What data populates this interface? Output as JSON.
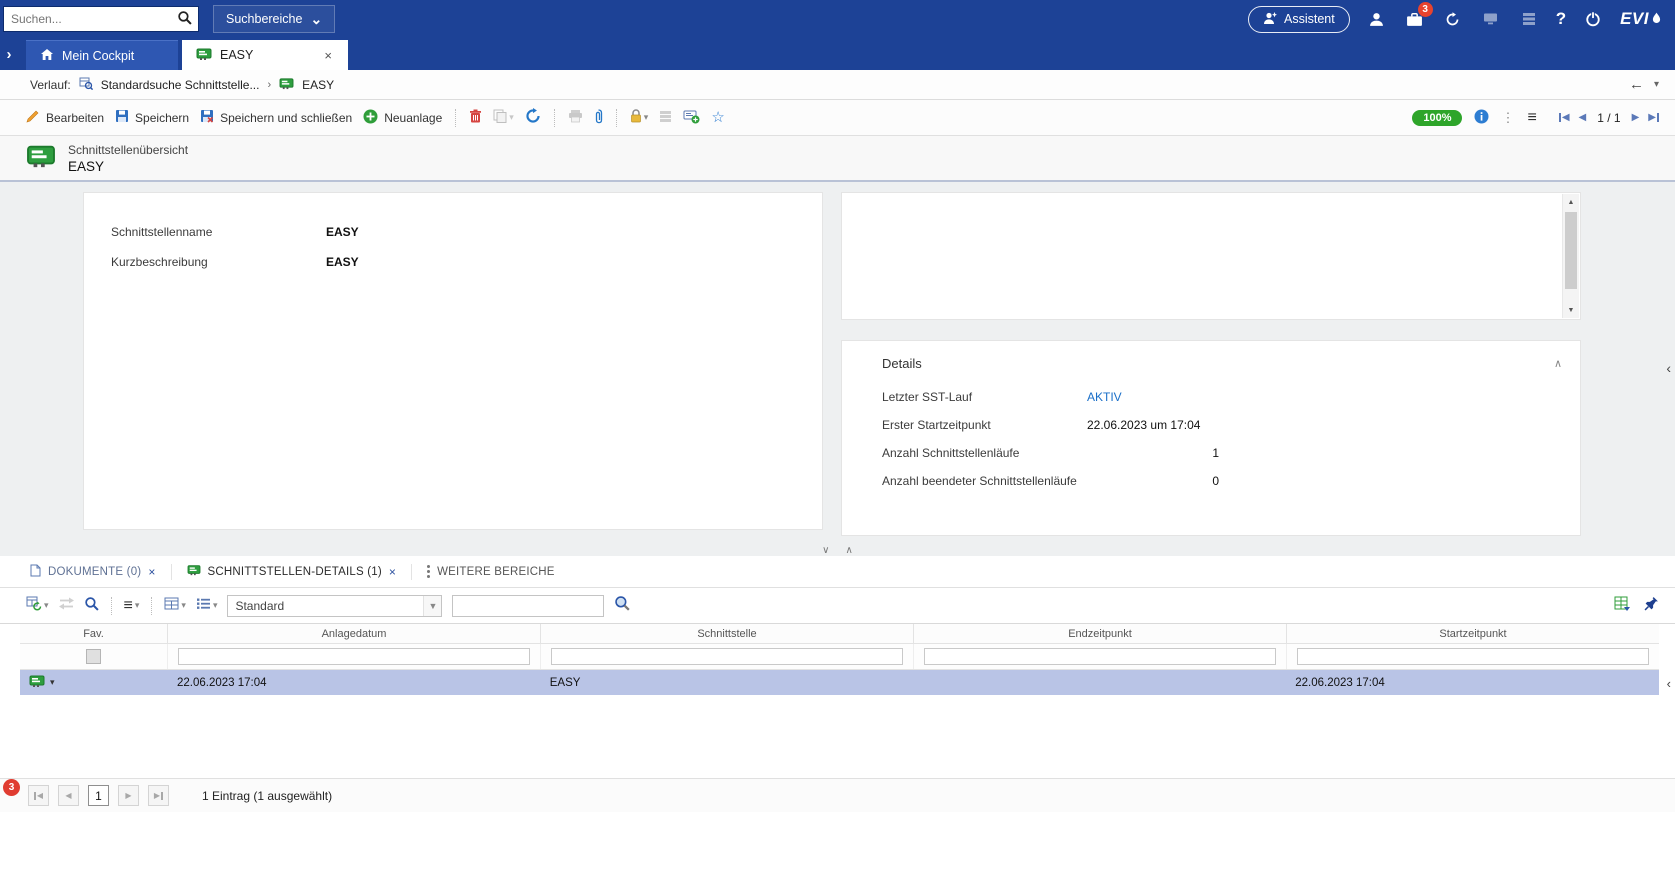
{
  "colors": {
    "topbar_blue": "#1d4296",
    "selection_row": "#b9c4e6",
    "status_green": "#2ea52a",
    "link_blue": "#1a6fc8",
    "alert_red": "#e03c31",
    "icon_green": "#2e9e3f"
  },
  "topbar": {
    "search_placeholder": "Suchen...",
    "scope_button": "Suchbereiche",
    "assistant_label": "Assistent",
    "notification_count": "3",
    "help_label": "?",
    "brand": "EVI"
  },
  "tabs": [
    {
      "label": "Mein Cockpit"
    },
    {
      "label": "EASY"
    }
  ],
  "breadcrumb": {
    "prefix": "Verlauf:",
    "items": [
      {
        "label": "Standardsuche Schnittstelle..."
      },
      {
        "label": "EASY"
      }
    ]
  },
  "toolbar": {
    "edit": "Bearbeiten",
    "save": "Speichern",
    "save_close": "Speichern und schließen",
    "new": "Neuanlage",
    "zoom": "100%",
    "pager": "1 / 1"
  },
  "record_header": {
    "type": "Schnittstellenübersicht",
    "title": "EASY"
  },
  "form": {
    "fields": [
      {
        "label": "Schnittstellenname",
        "value": "EASY"
      },
      {
        "label": "Kurzbeschreibung",
        "value": "EASY"
      }
    ]
  },
  "details": {
    "title": "Details",
    "rows": [
      {
        "label": "Letzter SST-Lauf",
        "value": "AKTIV"
      },
      {
        "label": "Erster Startzeitpunkt",
        "value": "22.06.2023 um 17:04"
      },
      {
        "label": "Anzahl Schnittstellenläufe",
        "value": "1"
      },
      {
        "label": "Anzahl beendeter Schnittstellenläufe",
        "value": "0"
      }
    ]
  },
  "bottom_tabs": [
    {
      "label": "DOKUMENTE (0)"
    },
    {
      "label": "SCHNITTSTELLEN-DETAILS (1)"
    },
    {
      "label": "WEITERE BEREICHE"
    }
  ],
  "grid_toolbar": {
    "view_select": "Standard"
  },
  "table": {
    "columns": [
      "Fav.",
      "Anlagedatum",
      "Schnittstelle",
      "Endzeitpunkt",
      "Startzeitpunkt"
    ],
    "rows": [
      [
        "22.06.2023 17:04",
        "EASY",
        "",
        "22.06.2023 17:04"
      ]
    ]
  },
  "pagination": {
    "page": "1",
    "status": "1 Eintrag (1 ausgewählt)"
  },
  "notifications": {
    "count": "3"
  }
}
